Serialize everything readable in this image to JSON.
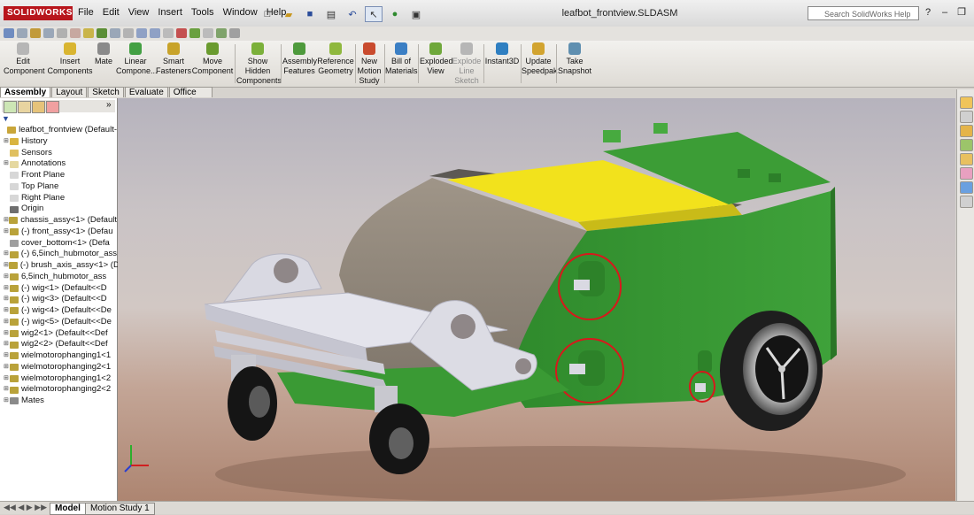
{
  "app": {
    "logo": "SOLIDWORKS",
    "menu": [
      "File",
      "Edit",
      "View",
      "Insert",
      "Tools",
      "Window",
      "Help"
    ],
    "document_title": "leafbot_frontview.SLDASM",
    "search_placeholder": "Search SolidWorks Help"
  },
  "command_manager": {
    "buttons": [
      {
        "label": "Edit\nComponent",
        "enabled": false,
        "color": "#b6b6b6"
      },
      {
        "label": "Insert\nComponents",
        "enabled": true,
        "color": "#d9b531"
      },
      {
        "label": "Mate",
        "enabled": true,
        "color": "#8a8a8a"
      },
      {
        "label": "Linear\nCompone...",
        "enabled": true,
        "color": "#43a043"
      },
      {
        "label": "Smart\nFasteners",
        "enabled": true,
        "color": "#c8a32a"
      },
      {
        "label": "Move\nComponent",
        "enabled": true,
        "color": "#6a9b2f"
      },
      {
        "label": "Show\nHidden\nComponents",
        "enabled": true,
        "color": "#7bb03a"
      },
      {
        "label": "Assembly\nFeatures",
        "enabled": true,
        "color": "#4e9a3c"
      },
      {
        "label": "Reference\nGeometry",
        "enabled": true,
        "color": "#8fb83e"
      },
      {
        "label": "New\nMotion\nStudy",
        "enabled": true,
        "color": "#c94b2e"
      },
      {
        "label": "Bill of\nMaterials",
        "enabled": true,
        "color": "#3b7fc4"
      },
      {
        "label": "Exploded\nView",
        "enabled": true,
        "color": "#6fa83b"
      },
      {
        "label": "Explode\nLine\nSketch",
        "enabled": false,
        "color": "#b6b6b6"
      },
      {
        "label": "Instant3D",
        "enabled": true,
        "color": "#2f7fc1"
      },
      {
        "label": "Update\nSpeedpak",
        "enabled": true,
        "color": "#d2a430"
      },
      {
        "label": "Take\nSnapshot",
        "enabled": true,
        "color": "#5f8fb0"
      }
    ]
  },
  "tabs": [
    {
      "label": "Assembly",
      "active": true
    },
    {
      "label": "Layout",
      "active": false
    },
    {
      "label": "Sketch",
      "active": false
    },
    {
      "label": "Evaluate",
      "active": false
    },
    {
      "label": "Office Products",
      "active": false
    }
  ],
  "feature_tree": [
    {
      "label": "leafbot_frontview  (Default-",
      "icon": "assembly-icon",
      "color": "#c9a63a",
      "expand": ""
    },
    {
      "label": "History",
      "icon": "history-icon",
      "color": "#d9b440",
      "expand": "+"
    },
    {
      "label": "Sensors",
      "icon": "sensors-icon",
      "color": "#e0c060",
      "expand": ""
    },
    {
      "label": "Annotations",
      "icon": "annotations-icon",
      "color": "#e5d8a0",
      "expand": "+"
    },
    {
      "label": "Front Plane",
      "icon": "plane-icon",
      "color": "#d7d7d7",
      "expand": ""
    },
    {
      "label": "Top Plane",
      "icon": "plane-icon",
      "color": "#d7d7d7",
      "expand": ""
    },
    {
      "label": "Right Plane",
      "icon": "plane-icon",
      "color": "#d7d7d7",
      "expand": ""
    },
    {
      "label": "Origin",
      "icon": "origin-icon",
      "color": "#6f6f6f",
      "expand": ""
    },
    {
      "label": "chassis_assy<1> (Default",
      "icon": "subassembly-icon",
      "color": "#b9a23a",
      "expand": "+"
    },
    {
      "label": "(-) front_assy<1> (Defau",
      "icon": "subassembly-icon",
      "color": "#b9a23a",
      "expand": "+"
    },
    {
      "label": "cover_bottom<1> (Defa",
      "icon": "part-icon",
      "color": "#9f9f9f",
      "expand": ""
    },
    {
      "label": "(-) 6,5inch_hubmotor_ass",
      "icon": "subassembly-icon",
      "color": "#b9a23a",
      "expand": "+"
    },
    {
      "label": "(-) brush_axis_assy<1> (D",
      "icon": "subassembly-icon",
      "color": "#b9a23a",
      "expand": "+"
    },
    {
      "label": "6,5inch_hubmotor_ass",
      "icon": "subassembly-icon",
      "color": "#b9a23a",
      "expand": "+"
    },
    {
      "label": "(-) wig<1> (Default<<D",
      "icon": "subassembly-icon",
      "color": "#b9a23a",
      "expand": "+"
    },
    {
      "label": "(-) wig<3> (Default<<D",
      "icon": "subassembly-icon",
      "color": "#b9a23a",
      "expand": "+"
    },
    {
      "label": "(-) wig<4> (Default<<De",
      "icon": "subassembly-icon",
      "color": "#b9a23a",
      "expand": "+"
    },
    {
      "label": "(-) wig<5> (Default<<De",
      "icon": "subassembly-icon",
      "color": "#b9a23a",
      "expand": "+"
    },
    {
      "label": "wig2<1> (Default<<Def",
      "icon": "subassembly-icon",
      "color": "#b9a23a",
      "expand": "+"
    },
    {
      "label": "wig2<2> (Default<<Def",
      "icon": "subassembly-icon",
      "color": "#b9a23a",
      "expand": "+"
    },
    {
      "label": "wielmotorophanging1<1",
      "icon": "subassembly-icon",
      "color": "#b9a23a",
      "expand": "+"
    },
    {
      "label": "wielmotorophanging2<1",
      "icon": "subassembly-icon",
      "color": "#b9a23a",
      "expand": "+"
    },
    {
      "label": "wielmotorophanging1<2",
      "icon": "subassembly-icon",
      "color": "#b9a23a",
      "expand": "+"
    },
    {
      "label": "wielmotorophanging2<2",
      "icon": "subassembly-icon",
      "color": "#b9a23a",
      "expand": "+"
    },
    {
      "label": "Mates",
      "icon": "mates-icon",
      "color": "#8a8a8a",
      "expand": "+"
    }
  ],
  "bottom_tabs": [
    {
      "label": "Model",
      "active": true
    },
    {
      "label": "Motion Study 1",
      "active": false
    }
  ],
  "model_colors": {
    "body_green": "#3b9a35",
    "top_yellow": "#f2e21c",
    "bracket_grey": "#d9d9e2",
    "annotation_red": "#d8181c"
  }
}
